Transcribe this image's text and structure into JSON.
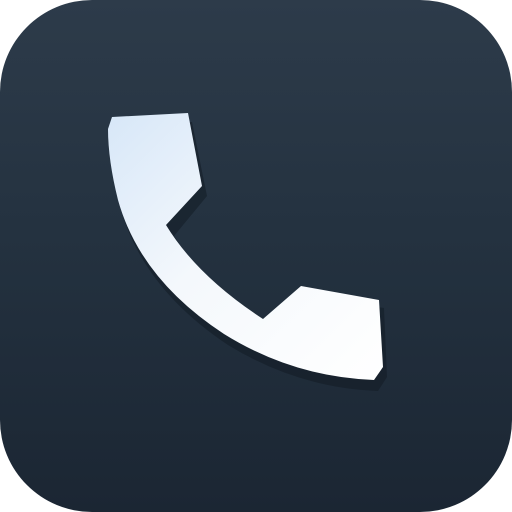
{
  "app_icon": {
    "name": "Phone",
    "glyph": "phone-handset-icon",
    "colors": {
      "background_top": "#2d3b4a",
      "background_bottom": "#1b2633",
      "glyph_light": "#ffffff",
      "glyph_tint": "#d7e7f8",
      "shadow": "#121b25"
    }
  }
}
